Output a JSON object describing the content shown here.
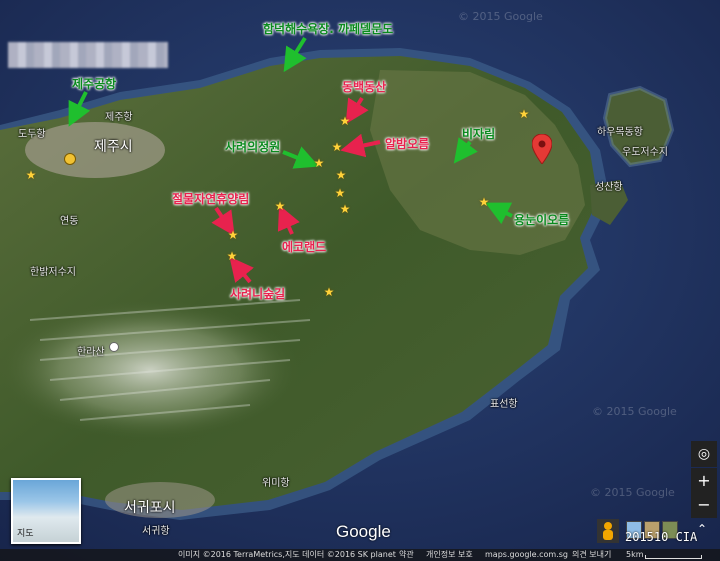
{
  "annotations": {
    "hamdeok": "함덕해수욕장. 까페델문도",
    "airport": "제주공항",
    "dongbaek": "동백동산",
    "albam": "알밤오름",
    "bijarim": "비자림",
    "saryeoui": "사려의정원",
    "jeolmul": "절물자연휴양림",
    "yongnuni": "용눈이오름",
    "ecoland": "에코랜드",
    "saryeoni": "사려니숲길"
  },
  "places": {
    "jeju_city": "제주시",
    "seogwipo": "서귀포시",
    "dodu": "도두항",
    "jeju_port": "제주항",
    "yeondong": "연동",
    "hanbam": "한밝저수지",
    "hallasan": "한라산",
    "hau": "하우목동항",
    "udo": "우도저수지",
    "seongsan": "성산항",
    "pyoseon": "표선항",
    "wimi": "위미항",
    "seogwi_port": "서귀항"
  },
  "watermark": "© 2015 Google",
  "google_logo": "Google",
  "thumbnail_label": "지도",
  "controls": {
    "locate": "◎",
    "zoom_in": "+",
    "zoom_out": "−",
    "expand": "⌃"
  },
  "footer": {
    "imagery": "이미지 ©2016 TerraMetrics,지도 데이터 ©2016 SK planet",
    "terms": "약관",
    "privacy": "개인정보 보호",
    "site": "maps.google.com.sg",
    "feedback": "의견 보내기",
    "scale": "5km"
  },
  "cia_text": "201510 CIA",
  "colors": {
    "green_label": "#0a8a1e",
    "pink_label": "#e8224e",
    "star": "#ffd23a",
    "pin": "#e53935",
    "sea": "#1f2f57"
  }
}
